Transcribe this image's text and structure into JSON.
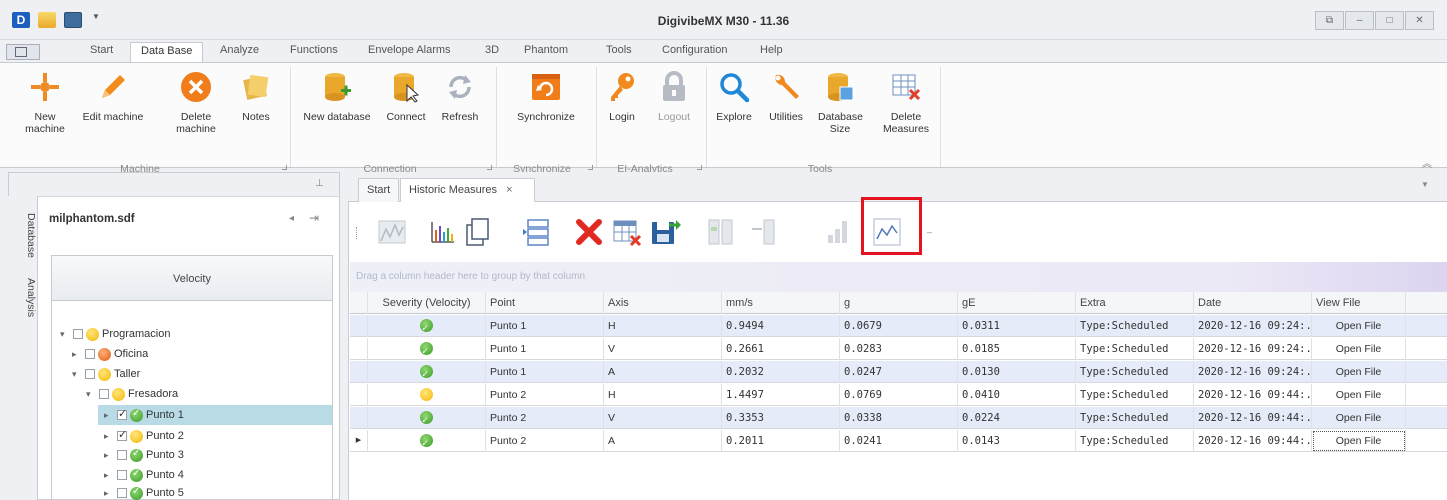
{
  "window": {
    "title": "DigivibeMX M30 - 11.36",
    "controls": [
      "restore-down",
      "minimize",
      "maximize",
      "close"
    ]
  },
  "ribbon_tabs": [
    {
      "label": "Start",
      "active": false
    },
    {
      "label": "Data Base",
      "active": true
    },
    {
      "label": "Analyze",
      "active": false
    },
    {
      "label": "Functions",
      "active": false
    },
    {
      "label": "Envelope Alarms",
      "active": false
    },
    {
      "label": "3D",
      "active": false
    },
    {
      "label": "Phantom",
      "active": false
    },
    {
      "label": "Tools",
      "active": false
    },
    {
      "label": "Configuration",
      "active": false
    },
    {
      "label": "Help",
      "active": false
    }
  ],
  "ribbon": {
    "machine": {
      "label": "Machine",
      "buttons": [
        {
          "label": "New machine",
          "icon": "new-machine-icon"
        },
        {
          "label": "Edit machine",
          "icon": "pencil-icon"
        },
        {
          "label": "Delete machine",
          "icon": "delete-circle-icon"
        },
        {
          "label": "Notes",
          "icon": "notes-icon"
        }
      ]
    },
    "connection": {
      "label": "Connection",
      "buttons": [
        {
          "label": "New database",
          "icon": "new-database-icon"
        },
        {
          "label": "Connect",
          "icon": "connect-icon"
        },
        {
          "label": "Refresh",
          "icon": "refresh-icon"
        }
      ]
    },
    "synchronize": {
      "label": "Synchronize",
      "buttons": [
        {
          "label": "Synchronize",
          "icon": "synchronize-icon"
        }
      ]
    },
    "analytics": {
      "label": "EI-Analytics",
      "buttons": [
        {
          "label": "Login",
          "icon": "key-icon"
        },
        {
          "label": "Logout",
          "icon": "lock-icon"
        }
      ]
    },
    "tools": {
      "label": "Tools",
      "buttons": [
        {
          "label": "Explore",
          "icon": "magnifier-icon"
        },
        {
          "label": "Utilities",
          "icon": "wrench-icon"
        },
        {
          "label": "Database Size",
          "icon": "database-size-icon"
        },
        {
          "label": "Delete Measures",
          "icon": "delete-measures-icon"
        }
      ]
    }
  },
  "left_panel": {
    "vertical_tabs": [
      "Database",
      "Analysis"
    ],
    "database_name": "milphantom.sdf",
    "velocity_button": "Velocity",
    "tree": [
      {
        "label": "Programacion",
        "level": 0,
        "expanded": true,
        "checked": false,
        "status": "yellow"
      },
      {
        "label": "Oficina",
        "level": 1,
        "expanded": false,
        "checked": false,
        "status": "orange"
      },
      {
        "label": "Taller",
        "level": 1,
        "expanded": true,
        "checked": false,
        "status": "yellow"
      },
      {
        "label": "Fresadora",
        "level": 2,
        "expanded": true,
        "checked": false,
        "status": "yellow"
      },
      {
        "label": "Punto 1",
        "level": 3,
        "expanded": false,
        "checked": true,
        "status": "green",
        "selected": true
      },
      {
        "label": "Punto 2",
        "level": 3,
        "expanded": false,
        "checked": true,
        "status": "yellow"
      },
      {
        "label": "Punto 3",
        "level": 3,
        "expanded": false,
        "checked": false,
        "status": "green"
      },
      {
        "label": "Punto 4",
        "level": 3,
        "expanded": false,
        "checked": false,
        "status": "green"
      },
      {
        "label": "Punto 5",
        "level": 3,
        "expanded": false,
        "checked": false,
        "status": "green"
      }
    ]
  },
  "document_tabs": [
    {
      "label": "Start",
      "active": false
    },
    {
      "label": "Historic Measures",
      "active": true,
      "close": "×"
    }
  ],
  "toolbar_icons": [
    "waterfall-icon",
    "spectrum-chart-icon",
    "copy-document-icon",
    "list-icon",
    "delete-x-icon",
    "delete-table-icon",
    "export-save-icon",
    "compare-left-icon",
    "compare-right-icon",
    "bar-chart-icon",
    "trend-icon"
  ],
  "group_hint": "Drag a column header here to group by that column",
  "grid": {
    "columns": [
      "Severity (Velocity)",
      "Point",
      "Axis",
      "mm/s",
      "g",
      "gE",
      "Extra",
      "Date",
      "View File"
    ],
    "rows": [
      {
        "severity": "green",
        "point": "Punto 1",
        "axis": "H",
        "mms": "0.9494",
        "g": "0.0679",
        "gE": "0.0311",
        "extra": "Type:Scheduled",
        "date": "2020-12-16 09:24:...",
        "file": "Open File"
      },
      {
        "severity": "green",
        "point": "Punto 1",
        "axis": "V",
        "mms": "0.2661",
        "g": "0.0283",
        "gE": "0.0185",
        "extra": "Type:Scheduled",
        "date": "2020-12-16 09:24:...",
        "file": "Open File"
      },
      {
        "severity": "green",
        "point": "Punto 1",
        "axis": "A",
        "mms": "0.2032",
        "g": "0.0247",
        "gE": "0.0130",
        "extra": "Type:Scheduled",
        "date": "2020-12-16 09:24:...",
        "file": "Open File"
      },
      {
        "severity": "yellow",
        "point": "Punto 2",
        "axis": "H",
        "mms": "1.4497",
        "g": "0.0769",
        "gE": "0.0410",
        "extra": "Type:Scheduled",
        "date": "2020-12-16 09:44:...",
        "file": "Open File"
      },
      {
        "severity": "green",
        "point": "Punto 2",
        "axis": "V",
        "mms": "0.3353",
        "g": "0.0338",
        "gE": "0.0224",
        "extra": "Type:Scheduled",
        "date": "2020-12-16 09:44:...",
        "file": "Open File"
      },
      {
        "severity": "green",
        "point": "Punto 2",
        "axis": "A",
        "mms": "0.2011",
        "g": "0.0241",
        "gE": "0.0143",
        "extra": "Type:Scheduled",
        "date": "2020-12-16 09:44:...",
        "file": "Open File",
        "current": true
      }
    ]
  },
  "colors": {
    "highlight_box": "#e4131f",
    "row_alt": "#e5ebf8",
    "tree_selected": "#b9dbe6"
  }
}
